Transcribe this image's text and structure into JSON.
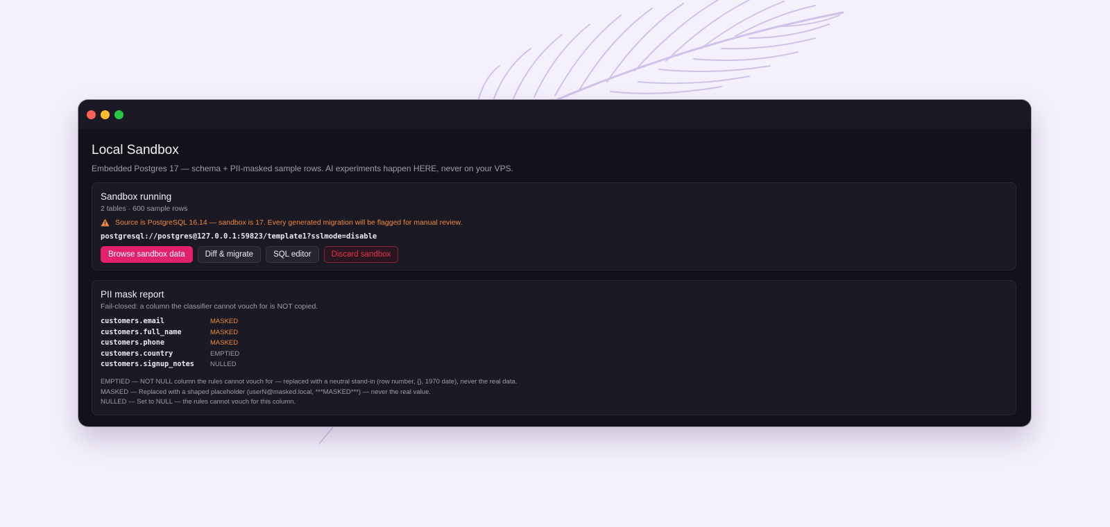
{
  "page": {
    "title": "Local Sandbox",
    "subtitle": "Embedded Postgres 17 — schema + PII-masked sample rows. AI experiments happen HERE, never on your VPS."
  },
  "status_card": {
    "title": "Sandbox running",
    "summary": "2 tables · 600 sample rows",
    "warning_icon": "warning-triangle-icon",
    "warning": "Source is PostgreSQL 16.14 — sandbox is 17. Every generated migration will be flagged for manual review.",
    "connection_string": "postgresql://postgres@127.0.0.1:59823/template1?sslmode=disable",
    "buttons": {
      "browse": "Browse sandbox data",
      "diff": "Diff & migrate",
      "sql": "SQL editor",
      "discard": "Discard sandbox"
    }
  },
  "pii_report": {
    "title": "PII mask report",
    "subtitle": "Fail-closed: a column the classifier cannot vouch for is NOT copied.",
    "rows": [
      {
        "column": "customers.email",
        "status": "MASKED"
      },
      {
        "column": "customers.full_name",
        "status": "MASKED"
      },
      {
        "column": "customers.phone",
        "status": "MASKED"
      },
      {
        "column": "customers.country",
        "status": "EMPTIED"
      },
      {
        "column": "customers.signup_notes",
        "status": "NULLED"
      }
    ],
    "legend": [
      "EMPTIED — NOT NULL column the rules cannot vouch for — replaced with a neutral stand-in (row number, {}, 1970 date), never the real data.",
      "MASKED — Replaced with a shaped placeholder (userN@masked.local, ***MASKED***) — never the real value.",
      "NULLED — Set to NULL — the rules cannot vouch for this column."
    ]
  },
  "colors": {
    "accent": "#e3206d",
    "warning": "#f08a3c",
    "danger": "#e8324f",
    "window_bg": "#131119",
    "desktop_bg": "#f5f1fc"
  },
  "window_controls": [
    "close-icon",
    "minimize-icon",
    "maximize-icon"
  ]
}
